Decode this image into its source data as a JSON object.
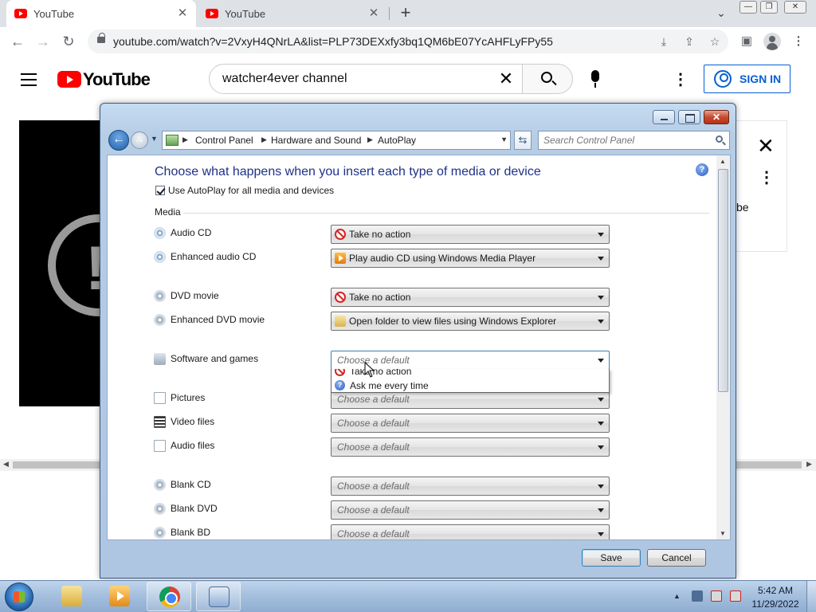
{
  "browser": {
    "tabs": [
      {
        "title": "YouTube",
        "active": true
      },
      {
        "title": "YouTube",
        "active": false
      }
    ],
    "new_tab": "+",
    "url": "youtube.com/watch?v=2VxyH4QNrLA&list=PLP73DEXxfy3bq1QM6bE07YcAHFLyFPy55"
  },
  "youtube": {
    "wordmark": "YouTube",
    "search_value": "watcher4ever channel",
    "sign_in": "SIGN IN",
    "panel_text_fragment": "be"
  },
  "dialog": {
    "breadcrumb": [
      "Control Panel",
      "Hardware and Sound",
      "AutoPlay"
    ],
    "search_placeholder": "Search Control Panel",
    "heading": "Choose what happens when you insert each type of media or device",
    "use_autoplay_label": "Use AutoPlay for all media and devices",
    "use_autoplay_checked": true,
    "section_media": "Media",
    "rows": [
      {
        "label": "Audio CD",
        "value": "Take no action",
        "icon": "no-action-icon"
      },
      {
        "label": "Enhanced audio CD",
        "value": "Play audio CD using Windows Media Player",
        "icon": "media-player-icon"
      },
      {
        "label": "DVD movie",
        "value": "Take no action",
        "icon": "no-action-icon"
      },
      {
        "label": "Enhanced DVD movie",
        "value": "Open folder to view files using Windows Explorer",
        "icon": "folder-icon"
      },
      {
        "label": "Software and games",
        "value": "Choose a default",
        "icon": "none",
        "open": true
      },
      {
        "label": "Pictures",
        "value": "Choose a default",
        "icon": "none"
      },
      {
        "label": "Video files",
        "value": "Choose a default",
        "icon": "none"
      },
      {
        "label": "Audio files",
        "value": "Choose a default",
        "icon": "none"
      },
      {
        "label": "Blank CD",
        "value": "Choose a default",
        "icon": "none"
      },
      {
        "label": "Blank DVD",
        "value": "Choose a default",
        "icon": "none"
      },
      {
        "label": "Blank BD",
        "value": "Choose a default",
        "icon": "none"
      }
    ],
    "dropdown_options": [
      "Take no action",
      "Ask me every time"
    ],
    "save": "Save",
    "cancel": "Cancel"
  },
  "taskbar": {
    "time": "5:42 AM",
    "date": "11/29/2022"
  }
}
